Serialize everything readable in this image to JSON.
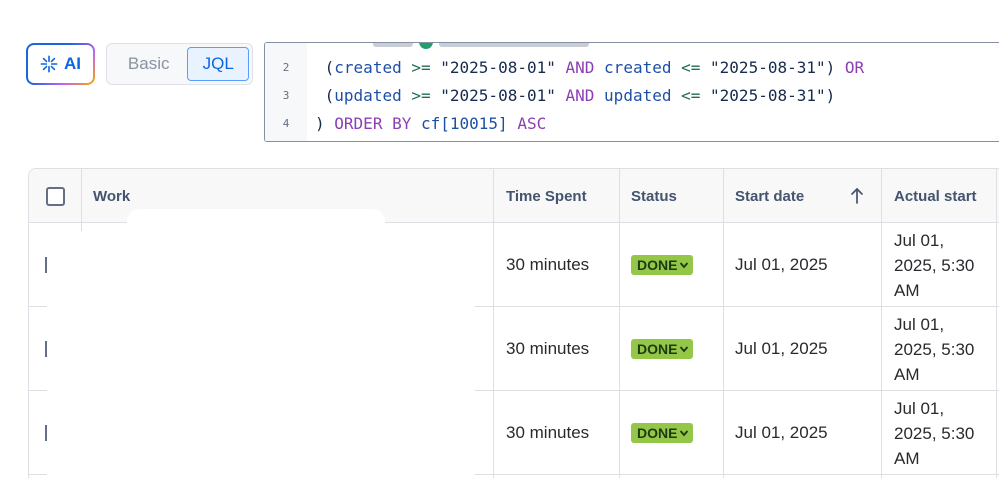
{
  "toolbar": {
    "ai_label": "AI",
    "mode_basic": "Basic",
    "mode_jql": "JQL"
  },
  "jql": {
    "lines": [
      {
        "number": "2",
        "tokens": [
          "(",
          "created",
          ">=",
          "\"2025-08-01\"",
          "AND",
          "created",
          "<=",
          "\"2025-08-31\"",
          ")",
          "OR"
        ]
      },
      {
        "number": "3",
        "tokens": [
          "(",
          "updated",
          ">=",
          "\"2025-08-01\"",
          "AND",
          "updated",
          "<=",
          "\"2025-08-31\"",
          ")"
        ]
      },
      {
        "number": "4",
        "tokens": [
          ")",
          "ORDER BY",
          "cf[10015]",
          "ASC"
        ]
      }
    ]
  },
  "table": {
    "columns": {
      "work": "Work",
      "time_spent": "Time Spent",
      "status": "Status",
      "start_date": "Start date",
      "actual_start": "Actual start"
    },
    "sort": {
      "column": "start_date",
      "direction": "ascending",
      "icon": "arrow-up-icon"
    },
    "rows": [
      {
        "time_spent": "30 minutes",
        "status": "DONE",
        "start_date": "Jul 01, 2025",
        "actual_start": "Jul 01, 2025, 5:30 AM"
      },
      {
        "time_spent": "30 minutes",
        "status": "DONE",
        "start_date": "Jul 01, 2025",
        "actual_start": "Jul 01, 2025, 5:30 AM"
      },
      {
        "time_spent": "30 minutes",
        "status": "DONE",
        "start_date": "Jul 01, 2025",
        "actual_start": "Jul 01, 2025, 5:30 AM"
      }
    ]
  },
  "colors": {
    "accent": "#0c66e4",
    "status_done": "#94c748",
    "jql_keyword": "#8c3fb2",
    "jql_field": "#1d4fa8",
    "jql_operator": "#216e4e"
  }
}
